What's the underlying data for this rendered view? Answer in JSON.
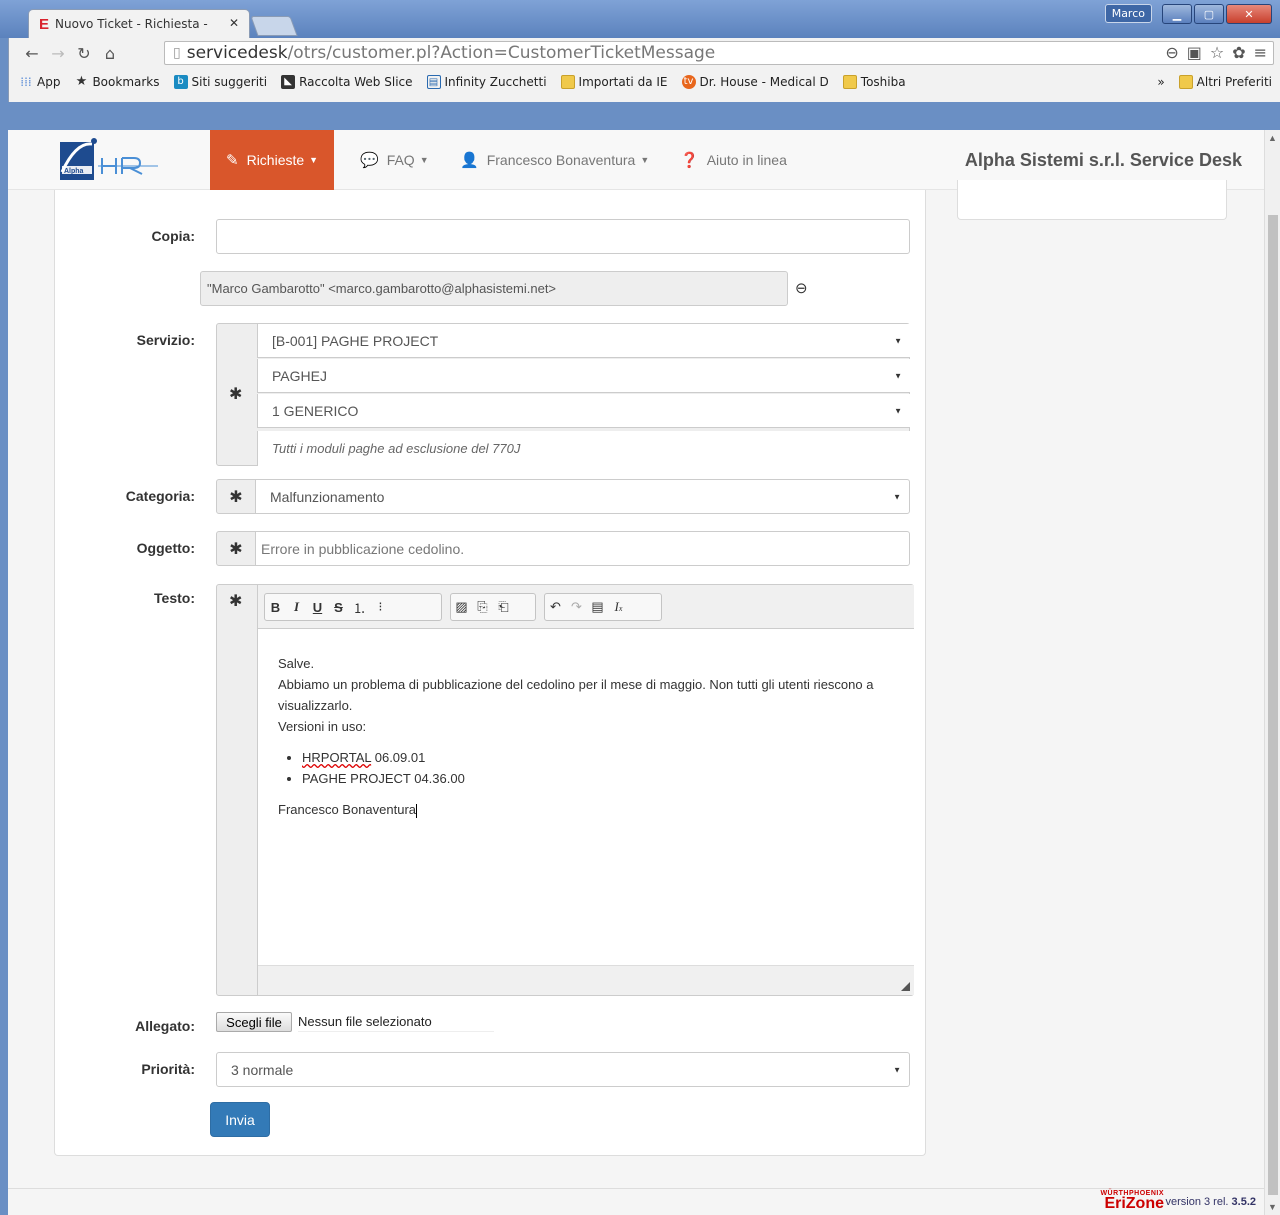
{
  "browser": {
    "tab_title": "Nuovo Ticket - Richiesta -",
    "tab_favicon": "E",
    "user_chip": "Marco",
    "url_host": "servicedesk",
    "url_path": "/otrs/customer.pl?Action=CustomerTicketMessage",
    "bookmarks": [
      {
        "label": "App",
        "icon": "apps-grid-icon"
      },
      {
        "label": "Bookmarks",
        "icon": "star-icon"
      },
      {
        "label": "Siti suggeriti",
        "icon": "bing-icon"
      },
      {
        "label": "Raccolta Web Slice",
        "icon": "webslice-icon"
      },
      {
        "label": "Infinity Zucchetti",
        "icon": "page-icon"
      },
      {
        "label": "Importati da IE",
        "icon": "folder-icon"
      },
      {
        "label": "Dr. House - Medical D",
        "icon": "tv-icon"
      },
      {
        "label": "Toshiba",
        "icon": "folder-icon"
      }
    ],
    "bookmarks_more": "»",
    "bookmarks_other": "Altri Preferiti"
  },
  "nav": {
    "richieste": "Richieste",
    "faq": "FAQ",
    "user": "Francesco Bonaventura",
    "help": "Aiuto in linea",
    "brand": "Alpha Sistemi s.r.l. Service Desk"
  },
  "form": {
    "copia_label": "Copia:",
    "copia_value": "",
    "cc_entry": "\"Marco Gambarotto\" <marco.gambarotto@alphasistemi.net>",
    "servizio_label": "Servizio:",
    "service_options": [
      "[B-001] PAGHE PROJECT",
      "PAGHEJ",
      "1 GENERICO"
    ],
    "service_description": "Tutti i moduli paghe ad esclusione del 770J",
    "categoria_label": "Categoria:",
    "categoria_value": "Malfunzionamento",
    "oggetto_label": "Oggetto:",
    "oggetto_placeholder": "Errore in pubblicazione cedolino.",
    "testo_label": "Testo:",
    "allegato_label": "Allegato:",
    "file_button": "Scegli file",
    "file_status": "Nessun file selezionato",
    "priorita_label": "Priorità:",
    "priorita_value": "3 normale",
    "submit": "Invia",
    "required_mark": "✱"
  },
  "editor": {
    "line1": "Salve.",
    "line2": "Abbiamo un problema di pubblicazione del cedolino per il mese di maggio. Non tutti gli utenti riescono a visualizzarlo.",
    "line3": "Versioni in uso:",
    "item1_name": "HRPORTAL",
    "item1_version": "06.09.01",
    "item2": "PAGHE PROJECT 04.36.00",
    "signature": "Francesco Bonaventura"
  },
  "footer": {
    "brand_top": "WÜRTHPHOENIX",
    "brand": "EriZone",
    "version_prefix": "version 3 rel.",
    "version": "3.5.2"
  },
  "colors": {
    "nav_active": "#d9562b",
    "primary_button": "#337ab7",
    "brand_red": "#cc0000"
  }
}
